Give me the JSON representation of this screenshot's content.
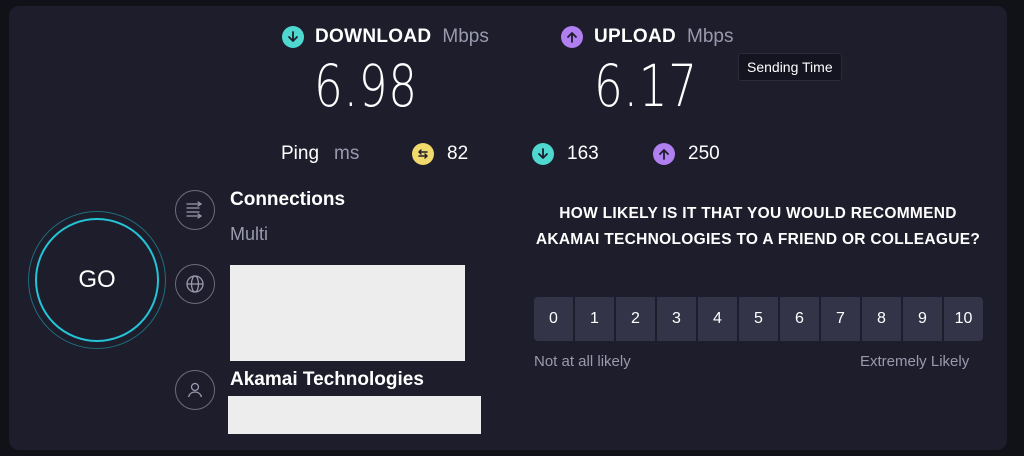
{
  "download": {
    "label": "DOWNLOAD",
    "unit": "Mbps",
    "value": "6.98",
    "icon": "arrow-down-circle-icon"
  },
  "upload": {
    "label": "UPLOAD",
    "unit": "Mbps",
    "value": "6.17",
    "icon": "arrow-up-circle-icon"
  },
  "tooltip": "Sending Time",
  "ping": {
    "label": "Ping",
    "unit": "ms",
    "unloaded": "82",
    "download": "163",
    "upload": "250"
  },
  "go_label": "GO",
  "connections": {
    "title": "Connections",
    "value": "Multi"
  },
  "server": {
    "title": ""
  },
  "provider": {
    "title": "Akamai Technologies"
  },
  "survey": {
    "question": "HOW LIKELY IS IT THAT YOU WOULD RECOMMEND AKAMAI TECHNOLOGIES TO A FRIEND OR COLLEAGUE?",
    "options": [
      "0",
      "1",
      "2",
      "3",
      "4",
      "5",
      "6",
      "7",
      "8",
      "9",
      "10"
    ],
    "low_label": "Not at all likely",
    "high_label": "Extremely Likely"
  },
  "colors": {
    "accent_teal": "#4fd8d0",
    "accent_purple": "#b07ff0",
    "accent_yellow": "#f2d96b",
    "panel": "#1d1d2c"
  }
}
